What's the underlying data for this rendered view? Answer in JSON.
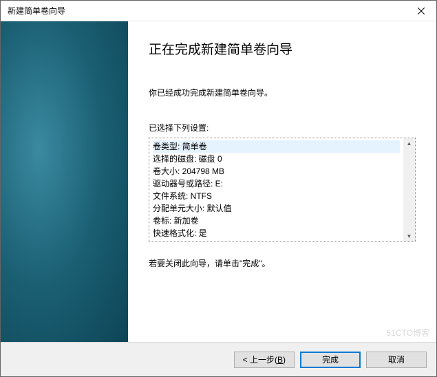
{
  "titlebar": {
    "title": "新建简单卷向导"
  },
  "content": {
    "heading": "正在完成新建简单卷向导",
    "intro": "你已经成功完成新建简单卷向导。",
    "settings_label": "已选择下列设置:",
    "settings": [
      "卷类型: 简单卷",
      "选择的磁盘: 磁盘 0",
      "卷大小: 204798 MB",
      "驱动器号或路径: E:",
      "文件系统: NTFS",
      "分配单元大小: 默认值",
      "卷标: 新加卷",
      "快速格式化: 是"
    ],
    "closing": "若要关闭此向导，请单击\"完成\"。"
  },
  "footer": {
    "back_prefix": "< 上一步(",
    "back_key": "B",
    "back_suffix": ")",
    "finish": "完成",
    "cancel": "取消"
  },
  "watermark": "51CTO博客"
}
